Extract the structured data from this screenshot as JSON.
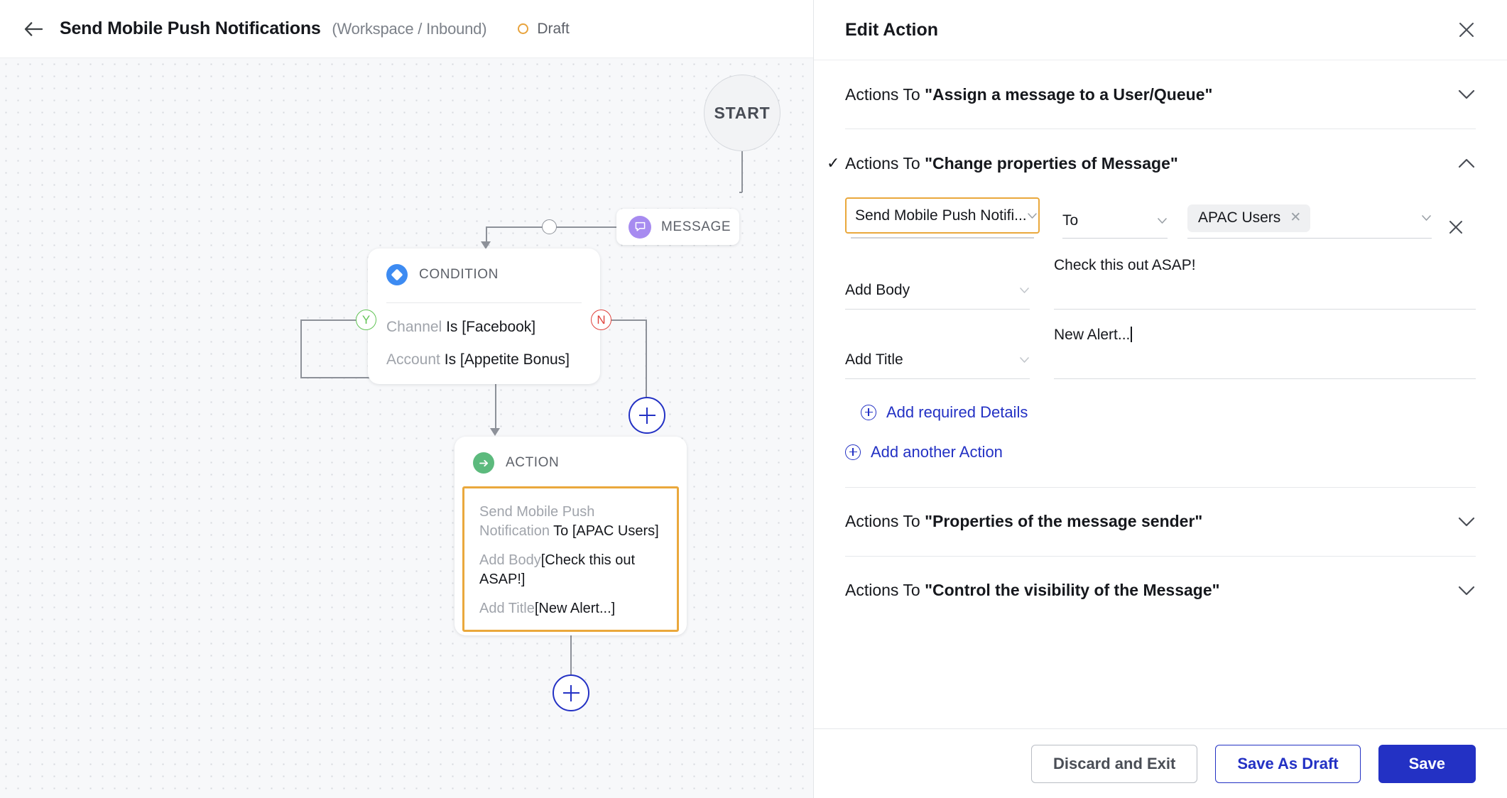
{
  "header": {
    "back_icon": "back-arrow-icon",
    "title": "Send Mobile Push Notifications",
    "subtitle": "(Workspace / Inbound)",
    "status": "Draft",
    "status_color": "#e8a33d"
  },
  "canvas": {
    "start_label": "START",
    "message_node": {
      "label": "MESSAGE",
      "icon": "message-bubble-icon",
      "icon_color": "#a78bf0"
    },
    "condition_node": {
      "label": "CONDITION",
      "icon": "diamond-icon",
      "icon_color": "#3d8bf2",
      "rules": [
        {
          "field": "Channel",
          "value": "Is [Facebook]"
        },
        {
          "field": "Account",
          "value": "Is [Appetite Bonus]"
        }
      ],
      "yes_badge": "Y",
      "no_badge": "N",
      "yes_color": "#63c457",
      "no_color": "#e0443e"
    },
    "action_node": {
      "label": "ACTION",
      "icon": "arrow-right-circle-icon",
      "icon_color": "#5cba7d",
      "highlight_color": "#eaa83c",
      "lines": [
        {
          "muted": "Send Mobile Push Notification",
          "value": "To [APAC Users]"
        },
        {
          "muted": "Add Body",
          "value": "[Check this out ASAP!]"
        },
        {
          "muted": "Add Title",
          "value": "[New Alert...]"
        }
      ]
    },
    "add_node_label": "+"
  },
  "panel": {
    "title": "Edit Action",
    "close_icon": "close-icon",
    "sections": [
      {
        "prefix": "Actions To ",
        "name": "\"Assign a message to a User/Queue\"",
        "expanded": false,
        "checked": false
      },
      {
        "prefix": "Actions To ",
        "name": "\"Change properties of Message\"",
        "expanded": true,
        "checked": true
      },
      {
        "prefix": "Actions To ",
        "name": "\"Properties of the message sender\"",
        "expanded": false,
        "checked": false
      },
      {
        "prefix": "Actions To ",
        "name": "\"Control the visibility of the Message\"",
        "expanded": false,
        "checked": false
      }
    ],
    "action_row": {
      "action_select": "Send Mobile Push Notifi...",
      "preposition_select": "To",
      "chip_label": "APAC Users",
      "chip_remove_icon": "chip-close-icon",
      "highlight_color": "#eaa83c",
      "remove_row_icon": "remove-row-icon"
    },
    "fields": [
      {
        "select": "Add Body",
        "value": "Check this out ASAP!",
        "has_cursor": false
      },
      {
        "select": "Add Title",
        "value": "New Alert...",
        "has_cursor": true
      }
    ],
    "add_details_label": "Add required Details",
    "add_action_label": "Add another Action"
  },
  "footer": {
    "discard_label": "Discard and Exit",
    "draft_label": "Save As Draft",
    "save_label": "Save",
    "accent_color": "#2331c4"
  }
}
